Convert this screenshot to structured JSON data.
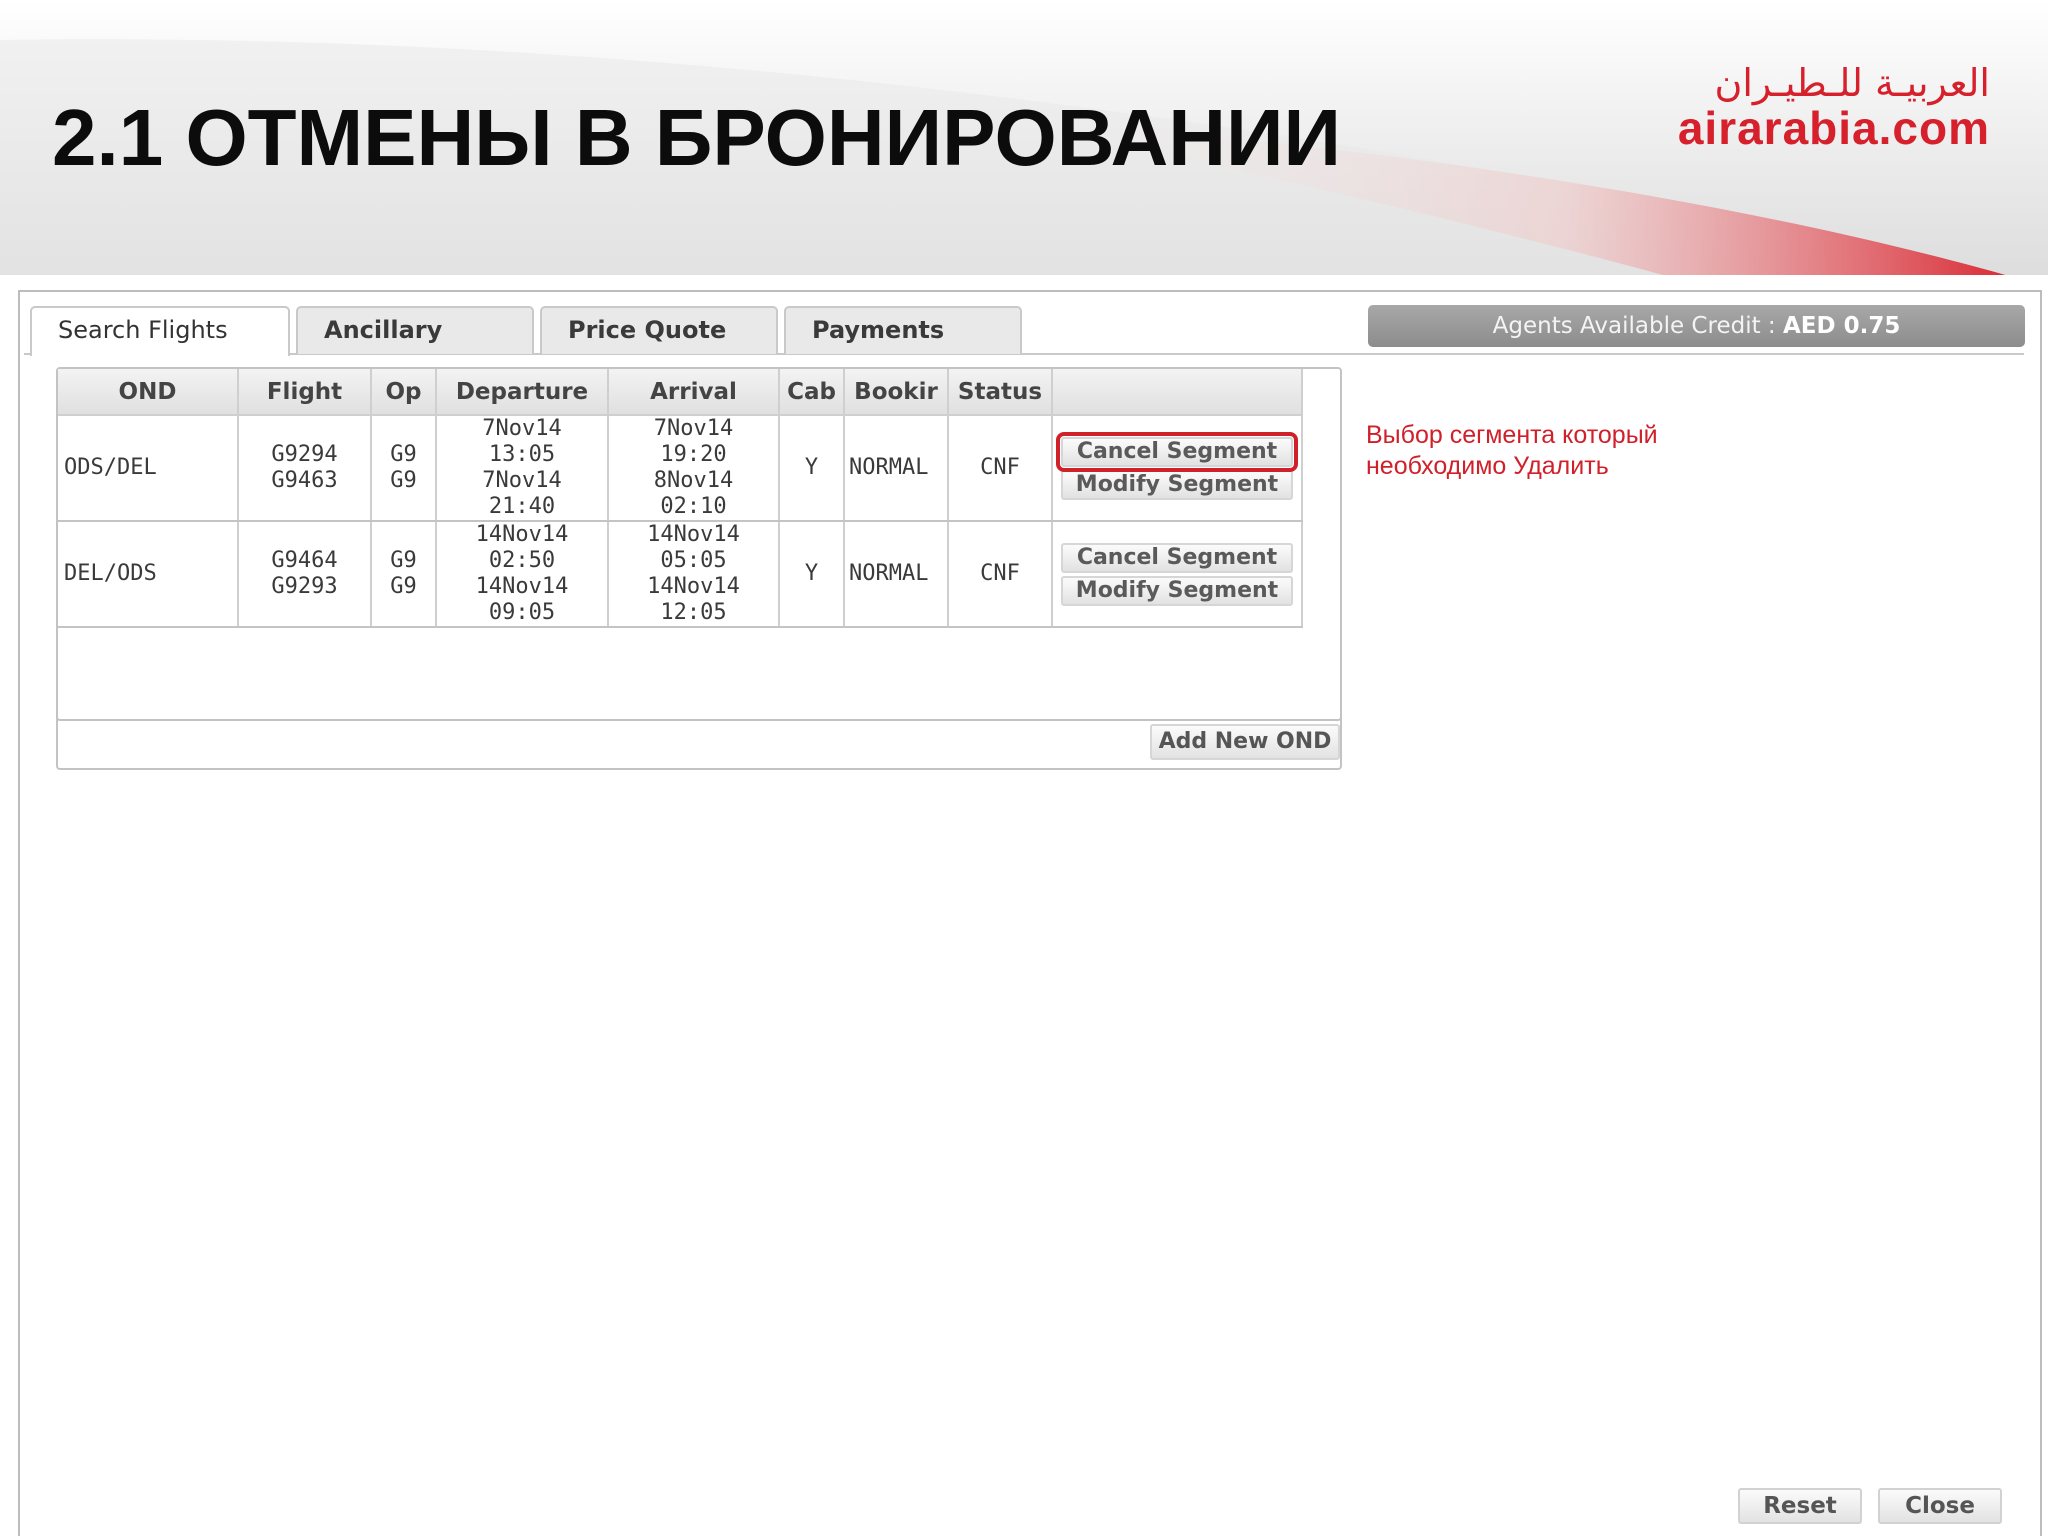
{
  "slide": {
    "title": "2.1 ОТМЕНЫ В БРОНИРОВАНИИ",
    "logo_arabic": "العربيـة للـطيـران",
    "logo_latin": "airarabia.com",
    "brand_color": "#d6202b"
  },
  "tabs": [
    {
      "label": "Search Flights",
      "active": true
    },
    {
      "label": "Ancillary",
      "active": false
    },
    {
      "label": "Price Quote",
      "active": false
    },
    {
      "label": "Payments",
      "active": false
    }
  ],
  "credit": {
    "label": "Agents Available Credit : ",
    "value": "AED 0.75"
  },
  "segments_table": {
    "headers": [
      "OND",
      "Flight",
      "Op",
      "Departure",
      "Arrival",
      "Cab",
      "Bookir",
      "Status",
      ""
    ],
    "rows": [
      {
        "ond": "ODS/DEL",
        "flights": [
          "G9294",
          "G9463"
        ],
        "ops": [
          "G9",
          "G9"
        ],
        "departure": [
          "7Nov14",
          "13:05",
          "7Nov14",
          "21:40"
        ],
        "arrival": [
          "7Nov14",
          "19:20",
          "8Nov14",
          "02:10"
        ],
        "cabin": "Y",
        "booking": "NORMAL",
        "status": "CNF",
        "cancel_label": "Cancel Segment",
        "modify_label": "Modify Segment"
      },
      {
        "ond": "DEL/ODS",
        "flights": [
          "G9464",
          "G9293"
        ],
        "ops": [
          "G9",
          "G9"
        ],
        "departure": [
          "14Nov14",
          "02:50",
          "14Nov14",
          "09:05"
        ],
        "arrival": [
          "14Nov14",
          "05:05",
          "14Nov14",
          "12:05"
        ],
        "cabin": "Y",
        "booking": "NORMAL",
        "status": "CNF",
        "cancel_label": "Cancel Segment",
        "modify_label": "Modify Segment"
      }
    ]
  },
  "annotation": "Выбор сегмента который необходимо Удалить",
  "buttons": {
    "add_new_ond": "Add New OND",
    "reset": "Reset",
    "close": "Close"
  }
}
